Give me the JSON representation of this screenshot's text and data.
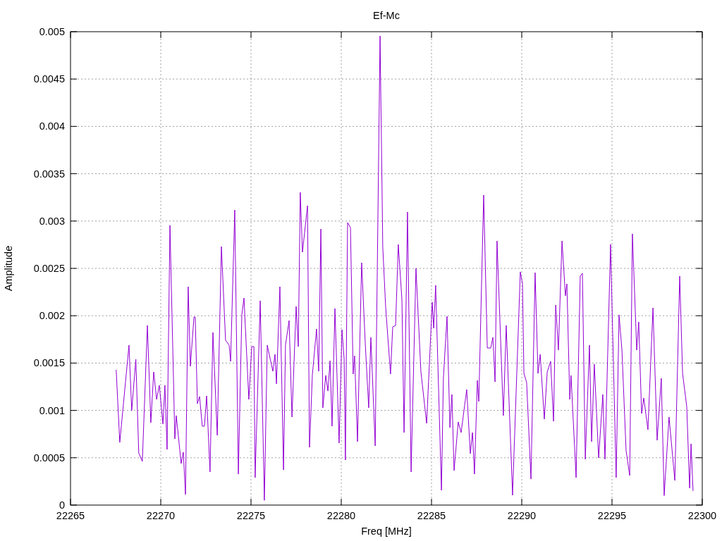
{
  "chart": {
    "chart_data": {
      "type": "line",
      "title": "Ef-Mc",
      "xlabel": "Freq [MHz]",
      "ylabel": "Amplitude",
      "xlim": [
        22265,
        22300
      ],
      "ylim": [
        0,
        0.005
      ],
      "grid": true,
      "xticks": [
        22265,
        22270,
        22275,
        22280,
        22285,
        22290,
        22295,
        22300
      ],
      "yticks": [
        0,
        0.0005,
        0.001,
        0.0015,
        0.002,
        0.0025,
        0.003,
        0.0035,
        0.004,
        0.0045,
        0.005
      ],
      "x": [
        22267.53,
        22267.73,
        22268.24,
        22268.39,
        22268.62,
        22268.78,
        22268.98,
        22269.26,
        22269.45,
        22269.61,
        22269.77,
        22269.92,
        22270.12,
        22270.23,
        22270.35,
        22270.51,
        22270.78,
        22270.86,
        22271.13,
        22271.25,
        22271.37,
        22271.52,
        22271.64,
        22271.84,
        22271.91,
        22272.03,
        22272.15,
        22272.3,
        22272.42,
        22272.54,
        22272.73,
        22272.89,
        22273.13,
        22273.36,
        22273.59,
        22273.79,
        22273.87,
        22274.1,
        22274.3,
        22274.49,
        22274.61,
        22274.88,
        22275.04,
        22275.16,
        22275.23,
        22275.51,
        22275.74,
        22275.9,
        22276.21,
        22276.33,
        22276.41,
        22276.6,
        22276.8,
        22276.91,
        22277.11,
        22277.27,
        22277.5,
        22277.62,
        22277.73,
        22277.85,
        22278.13,
        22278.24,
        22278.4,
        22278.63,
        22278.75,
        22278.87,
        22278.98,
        22279.14,
        22279.26,
        22279.38,
        22279.49,
        22279.65,
        22279.88,
        22280.04,
        22280.16,
        22280.23,
        22280.35,
        22280.51,
        22280.66,
        22280.74,
        22280.9,
        22281.13,
        22281.33,
        22281.52,
        22281.64,
        22281.88,
        22282.15,
        22282.3,
        22282.46,
        22282.73,
        22282.85,
        22283.01,
        22283.16,
        22283.36,
        22283.48,
        22283.67,
        22283.87,
        22284.14,
        22284.41,
        22284.73,
        22285.04,
        22285.12,
        22285.23,
        22285.55,
        22285.66,
        22285.86,
        22286.02,
        22286.13,
        22286.25,
        22286.48,
        22286.64,
        22286.95,
        22287.15,
        22287.27,
        22287.38,
        22287.54,
        22287.62,
        22287.89,
        22288.09,
        22288.28,
        22288.4,
        22288.52,
        22288.63,
        22288.98,
        22289.14,
        22289.49,
        22289.92,
        22290.04,
        22290.12,
        22290.27,
        22290.51,
        22290.74,
        22290.9,
        22291.02,
        22291.25,
        22291.41,
        22291.6,
        22291.76,
        22291.88,
        22292.03,
        22292.23,
        22292.42,
        22292.5,
        22292.66,
        22292.73,
        22293.01,
        22293.24,
        22293.36,
        22293.52,
        22293.75,
        22293.87,
        22294.02,
        22294.26,
        22294.49,
        22294.61,
        22294.92,
        22295.23,
        22295.39,
        22295.55,
        22295.78,
        22295.98,
        22296.13,
        22296.37,
        22296.48,
        22296.64,
        22296.76,
        22296.99,
        22297.27,
        22297.5,
        22297.73,
        22297.89,
        22298.16,
        22298.48,
        22298.75,
        22298.91,
        22299.14,
        22299.3,
        22299.38,
        22299.49
      ],
      "series": [
        {
          "color": "#9400d3",
          "values": [
            0.001429,
            0.000662,
            0.001689,
            0.000997,
            0.00154,
            0.000551,
            0.000461,
            0.001897,
            0.00087,
            0.001406,
            0.001116,
            0.001265,
            0.000856,
            0.001265,
            0.000588,
            0.002954,
            0.000699,
            0.000945,
            0.000439,
            0.000558,
            0.000112,
            0.002306,
            0.001466,
            0.001986,
            0.001986,
            0.001071,
            0.001146,
            0.000833,
            0.000833,
            0.001153,
            0.00035,
            0.001823,
            0.000737,
            0.00273,
            0.001741,
            0.001689,
            0.001518,
            0.003117,
            0.000327,
            0.002009,
            0.002187,
            0.001116,
            0.001674,
            0.001674,
            0.00029,
            0.002158,
            5e-05,
            0.001689,
            0.001414,
            0.001592,
            0.00128,
            0.002306,
            0.000372,
            0.001689,
            0.001949,
            0.00093,
            0.002098,
            0.001674,
            0.003303,
            0.002671,
            0.003162,
            0.00061,
            0.001376,
            0.00186,
            0.001414,
            0.002916,
            0.001027,
            0.001369,
            0.001205,
            0.001525,
            0.000833,
            0.002076,
            0.000655,
            0.001853,
            0.00154,
            0.000476,
            0.002983,
            0.002931,
            0.001384,
            0.001577,
            0.00067,
            0.002559,
            0.001704,
            0.001027,
            0.001771,
            0.000625,
            0.004955,
            0.002723,
            0.002091,
            0.001384,
            0.001882,
            0.001897,
            0.002753,
            0.002172,
            0.000766,
            0.003095,
            0.00035,
            0.0025,
            0.001414,
            0.000863,
            0.002143,
            0.001868,
            0.002321,
            0.000156,
            0.001347,
            0.001994,
            0.000818,
            0.001168,
            0.000365,
            0.000878,
            0.000766,
            0.00122,
            0.000543,
            0.000766,
            0.000327,
            0.001317,
            0.001094,
            0.003274,
            0.001659,
            0.001659,
            0.001771,
            0.001302,
            0.00279,
            0.000945,
            0.001897,
            0.000104,
            0.002463,
            0.002336,
            0.001391,
            0.001295,
            0.000275,
            0.002455,
            0.001391,
            0.001592,
            0.000908,
            0.001406,
            0.001518,
            0.000885,
            0.002113,
            0.001637,
            0.00279,
            0.00221,
            0.002336,
            0.001116,
            0.001369,
            0.00029,
            0.002418,
            0.002448,
            0.000484,
            0.001689,
            0.00067,
            0.001488,
            0.000498,
            0.001168,
            0.000484,
            0.002753,
            0.00029,
            0.002009,
            0.001637,
            0.000573,
            0.000312,
            0.002865,
            0.001637,
            0.001934,
            0.000967,
            0.001131,
            0.000796,
            0.002083,
            0.000684,
            0.001339,
            0.0001,
            0.00093,
            0.00026,
            0.002418,
            0.001391,
            0.001042,
            0.000179,
            0.000647,
            0.000149
          ]
        }
      ]
    }
  }
}
